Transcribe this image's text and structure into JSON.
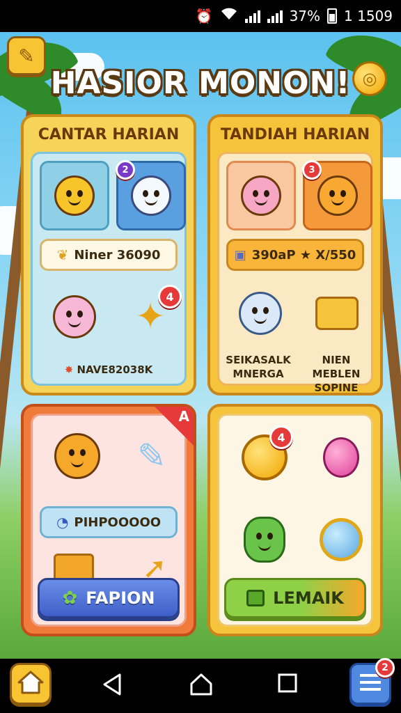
{
  "status_bar": {
    "battery_percent": "37%",
    "time": "1 1509"
  },
  "header": {
    "title": "HASIOR MONON!"
  },
  "panels": {
    "daily_challenge": {
      "title": "CANTAR HARIAN",
      "progress_label": "Niner 36090",
      "footer_label": "NAVE82038K",
      "tile_badge": "2",
      "item_badge": "4"
    },
    "daily_reward": {
      "title": "TANDIAH HARIAN",
      "progress_label": "390aP ★ X/550",
      "left_caption": "SEIKASALK MNERGA",
      "right_caption": "NIEN MEBLEN SOPINE",
      "tile_badge": "3"
    },
    "fashion": {
      "corner_badge": "A",
      "pill_label": "PIHPOOOOO",
      "button_label": "FAPION"
    },
    "shop": {
      "medal_badge": "4",
      "button_label": "LEMAIK"
    }
  },
  "nav": {
    "menu_badge": "2"
  },
  "colors": {
    "gold": "#f6c43a",
    "orange": "#f07a3a",
    "blue_button": "#3f5fc8",
    "green_button": "#8ed046",
    "badge_red": "#e63a3a"
  }
}
